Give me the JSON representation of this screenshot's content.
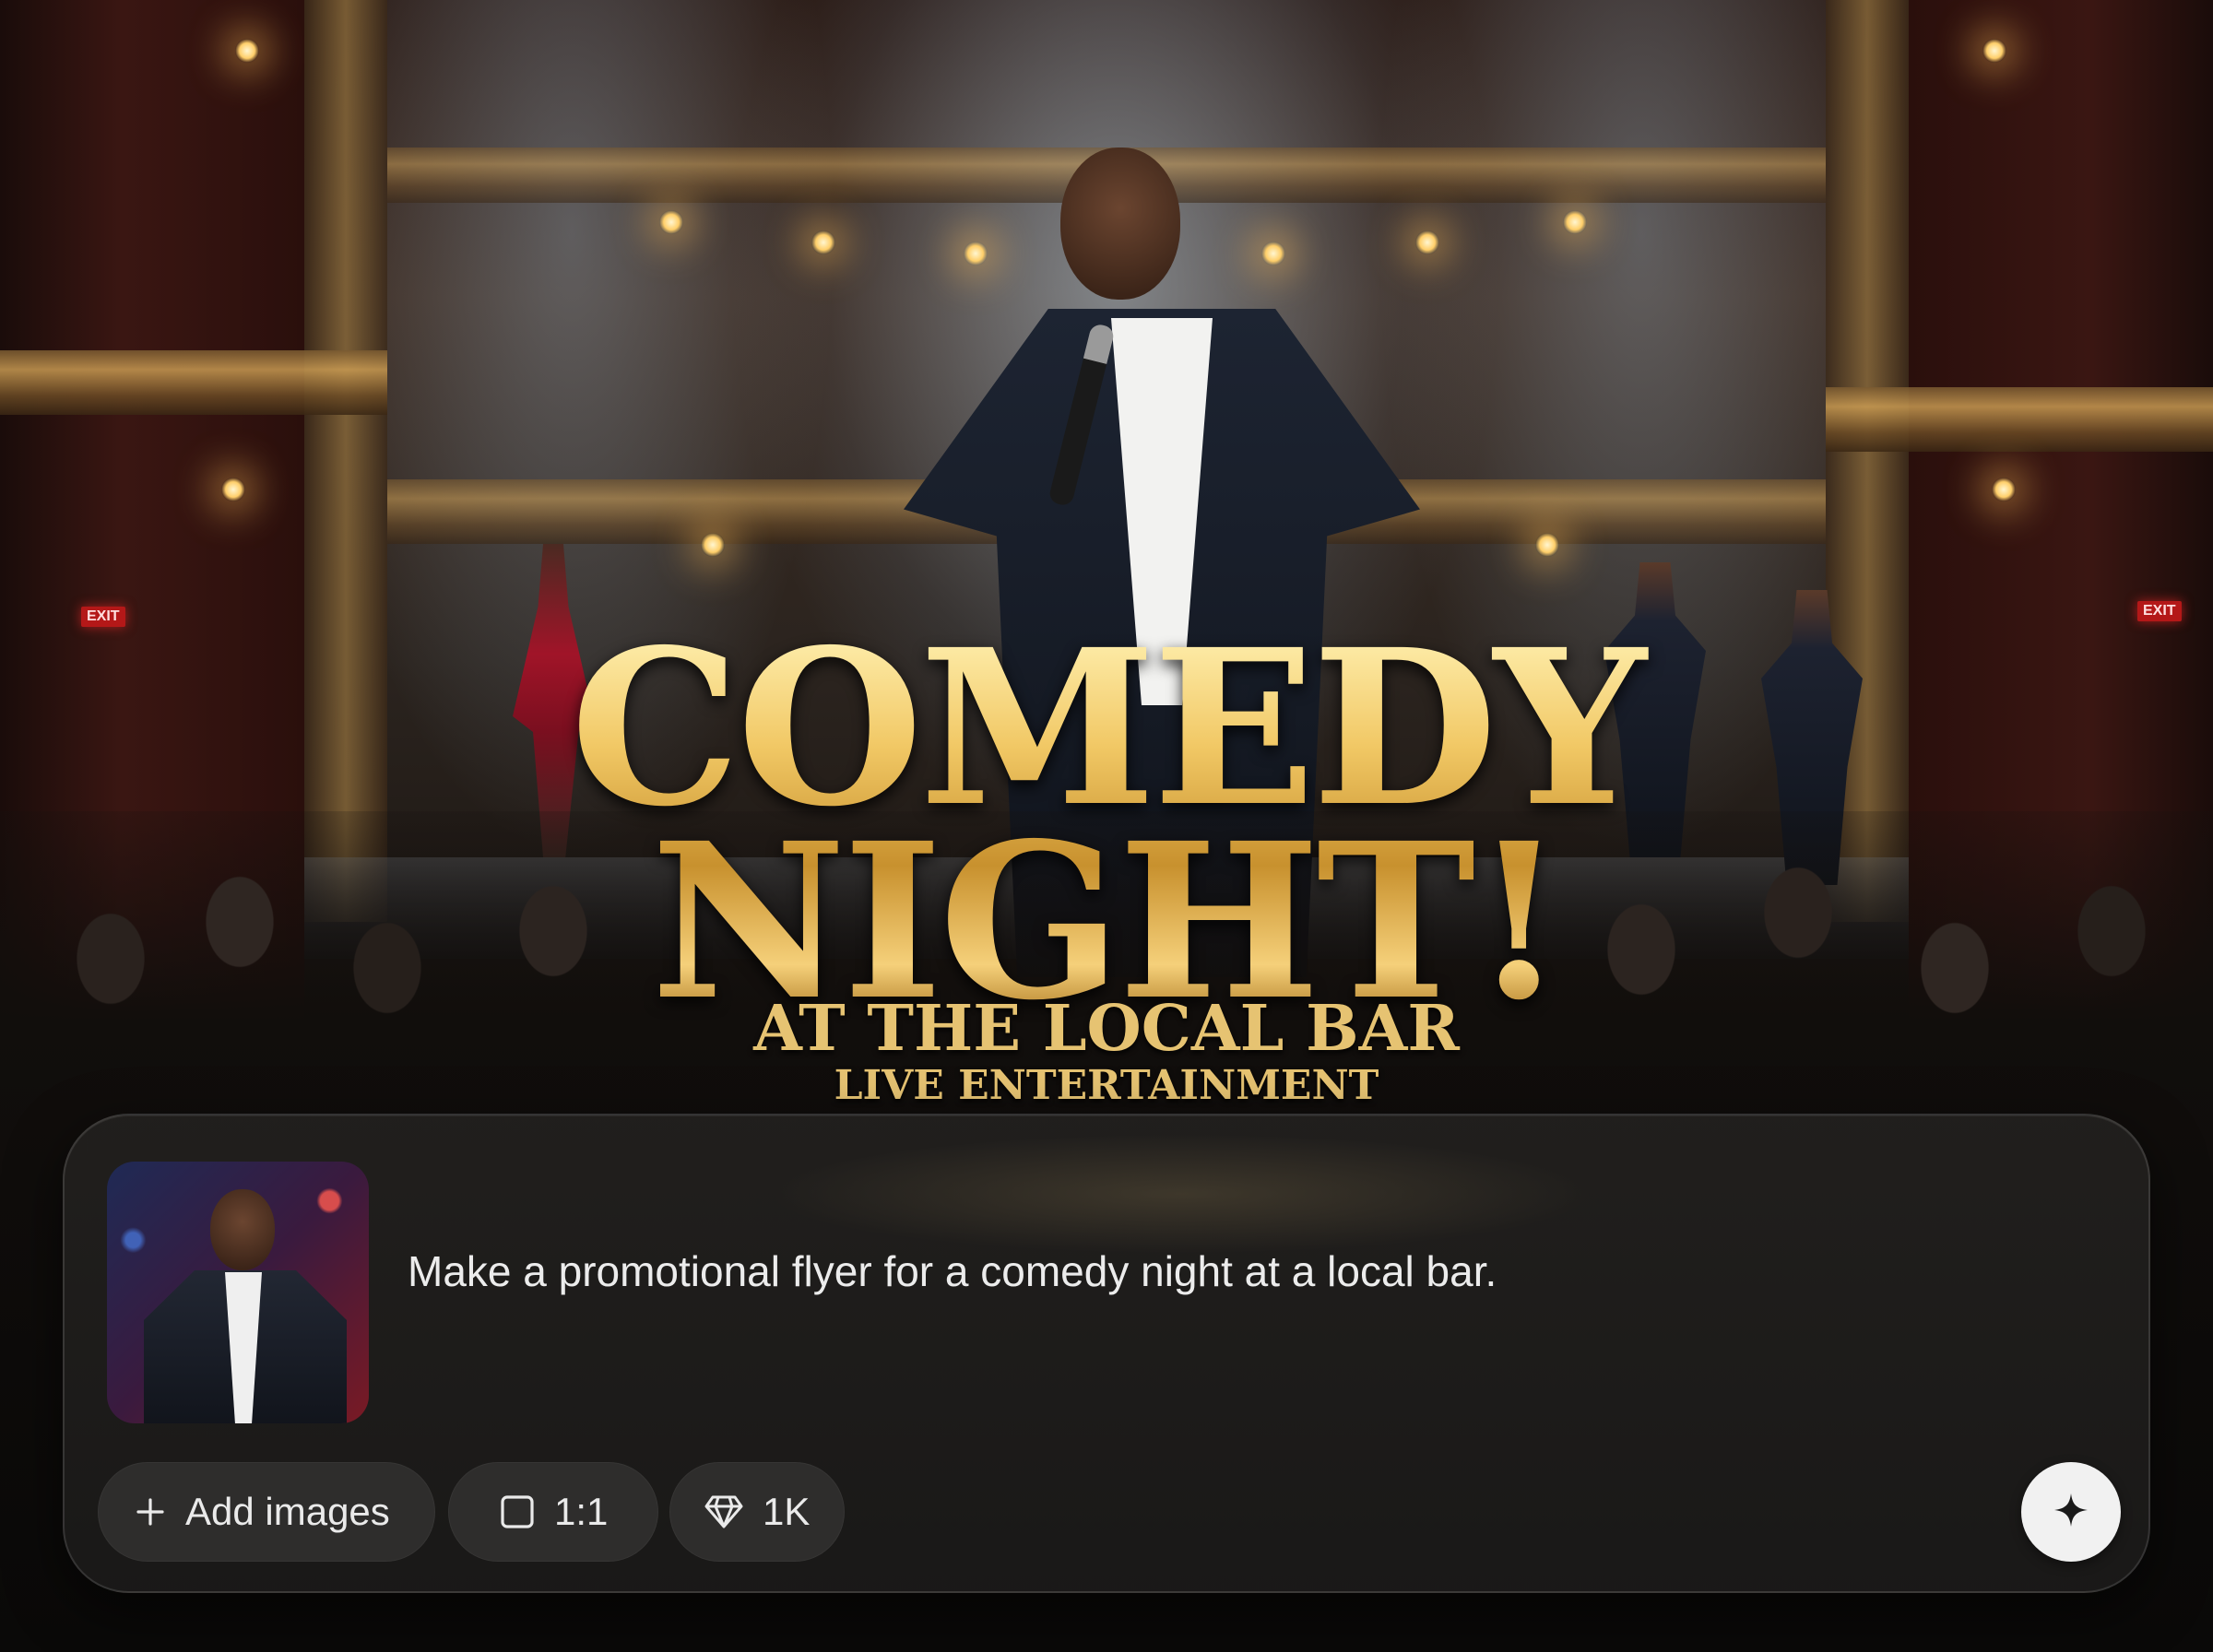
{
  "poster": {
    "headline_line1": "COMEDY",
    "headline_line2": "NIGHT!",
    "subtitle": "AT THE LOCAL BAR",
    "tagline": "LIVE ENTERTAINMENT",
    "exit_sign": "EXIT"
  },
  "composer": {
    "reference_image_icon": "thumbnail-comedian",
    "prompt": "Make a promotional flyer for a comedy night at a local bar.",
    "add_images_label": "Add images",
    "add_images_icon": "plus-icon",
    "aspect_ratio_label": "1:1",
    "aspect_ratio_icon": "square-icon",
    "resolution_label": "1K",
    "resolution_icon": "diamond-icon",
    "generate_icon": "sparkle-icon"
  },
  "colors": {
    "gold": "#e2b851",
    "panel_bg": "#1e1d1c",
    "chip_bg": "#2e2d2c",
    "send_bg": "#f1f1f1"
  }
}
